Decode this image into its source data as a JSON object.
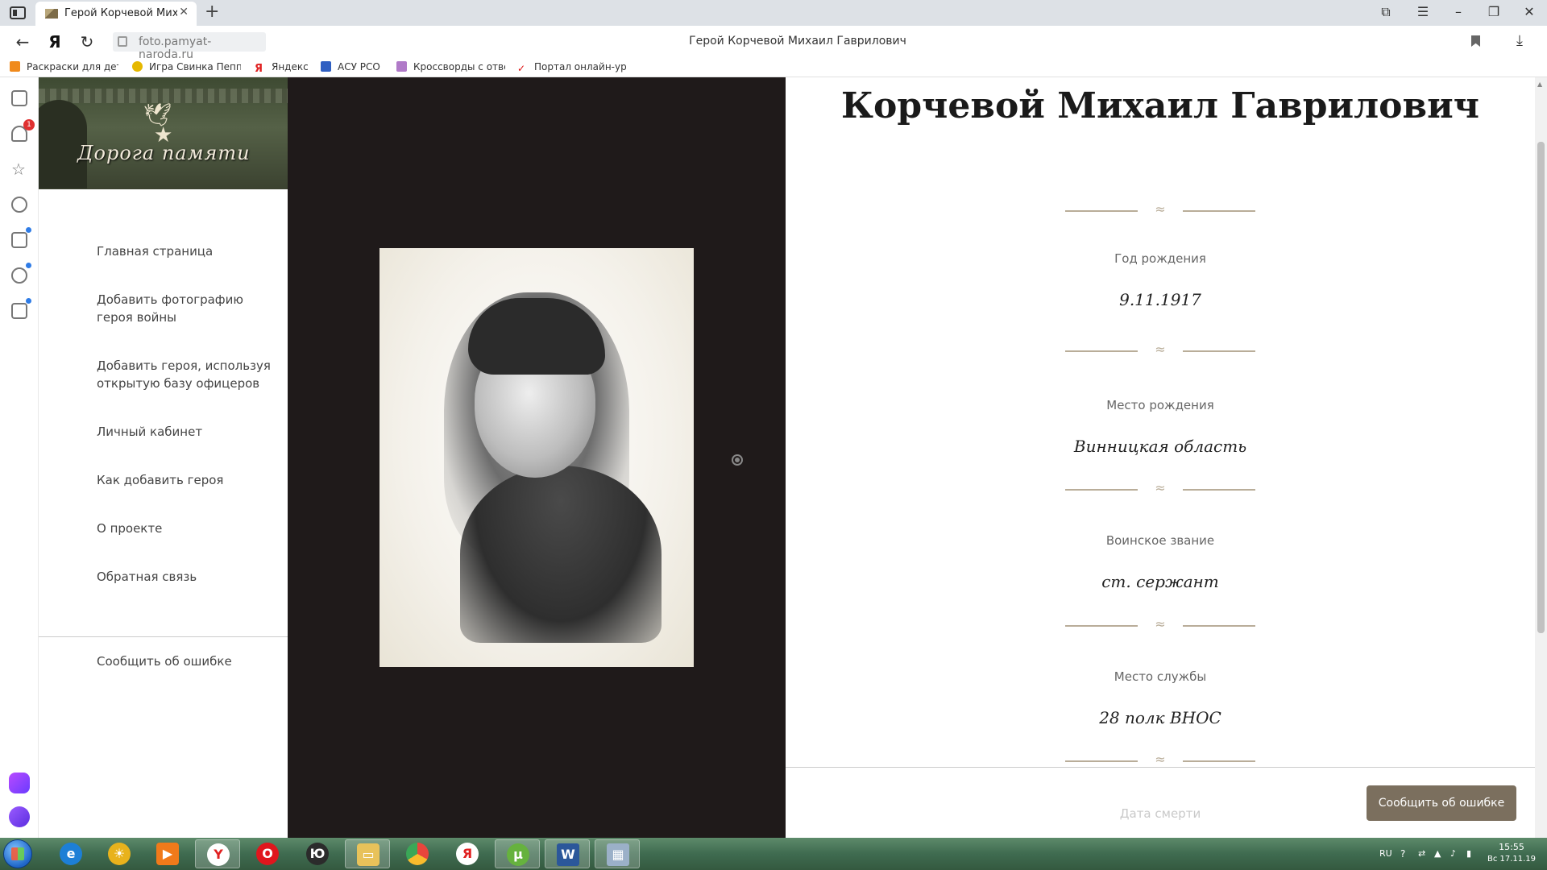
{
  "browser": {
    "tab_title": "Герой Корчевой Михаил Гаврилович",
    "url": "foto.pamyat-naroda.ru",
    "page_title": "Герой Корчевой Михаил Гаврилович",
    "bookmarks": [
      {
        "label": "Раскраски для детей",
        "icon_color": "#f08a1c"
      },
      {
        "label": "Игра Свинка Пеппа",
        "icon_color": "#e6b800"
      },
      {
        "label": "Яндекс",
        "icon_color": "#e02020"
      },
      {
        "label": "АСУ РСО",
        "icon_color": "#2f5fc2"
      },
      {
        "label": "Кроссворды с ответами",
        "icon_color": "#b07ac8"
      },
      {
        "label": "Портал онлайн-уроков",
        "icon_color": "#d11"
      }
    ],
    "notification_count": "1"
  },
  "site": {
    "logo_text": "Дорога памяти",
    "menu": [
      "Главная страница",
      "Добавить фотографию героя войны",
      "Добавить героя, используя открытую базу офицеров",
      "Личный кабинет",
      "Как добавить героя",
      "О проекте",
      "Обратная связь"
    ],
    "menu_report": "Сообщить об ошибке"
  },
  "hero": {
    "name": "Корчевой Михаил Гаврилович",
    "fields": [
      {
        "label": "Год рождения",
        "value": "9.11.1917"
      },
      {
        "label": "Место рождения",
        "value": "Винницкая область"
      },
      {
        "label": "Воинское звание",
        "value": "ст. сержант"
      },
      {
        "label": "Место службы",
        "value": "28 полк ВНОС"
      }
    ],
    "next_label": "Дата смерти",
    "report_button": "Сообщить об ошибке"
  },
  "taskbar": {
    "lang": "RU",
    "time": "15:55",
    "date": "Вс 17.11.19"
  },
  "colors": {
    "accent_button": "#7b6f5e",
    "photo_background": "#1f1a1a",
    "ornament": "#b9ad99"
  }
}
